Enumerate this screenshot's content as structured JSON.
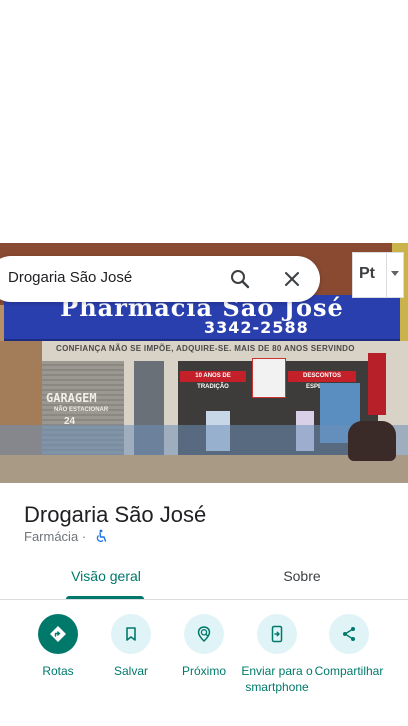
{
  "search": {
    "query": "Drogaria São José",
    "search_icon": "search-icon",
    "close_icon": "close-icon"
  },
  "language_menu": {
    "glyph": "Pt",
    "icon": "chevron-down-icon"
  },
  "photo": {
    "sign_name": "Pharmacia São José",
    "sign_phone": "3342-2588",
    "tagline": "CONFIANÇA NÃO SE IMPÕE, ADQUIRE-SE.  MAIS DE 80 ANOS SERVINDO",
    "garage_text": "GARAGEM",
    "garage_sub": "NÃO ESTACIONAR",
    "garage_num": "24",
    "banner_left": "10 ANOS DE TRADIÇÃO",
    "banner_right": "DESCONTOS ESPECIAIS"
  },
  "place": {
    "name": "Drogaria São José",
    "category": "Farmácia",
    "separator": "·",
    "accessibility_icon": "wheelchair-icon"
  },
  "tabs": [
    {
      "label": "Visão geral",
      "active": true
    },
    {
      "label": "Sobre",
      "active": false
    }
  ],
  "actions": [
    {
      "label": "Rotas",
      "icon": "directions-icon"
    },
    {
      "label": "Salvar",
      "icon": "bookmark-icon"
    },
    {
      "label": "Próximo",
      "icon": "nearby-icon"
    },
    {
      "label": "Enviar para o smartphone",
      "icon": "send-to-phone-icon"
    },
    {
      "label": "Compartilhar",
      "icon": "share-icon"
    }
  ],
  "colors": {
    "accent": "#00796b",
    "accent_light": "#e0f4f7",
    "sign_blue": "#2a3fae",
    "text_primary": "#202124",
    "text_secondary": "#70757a"
  }
}
